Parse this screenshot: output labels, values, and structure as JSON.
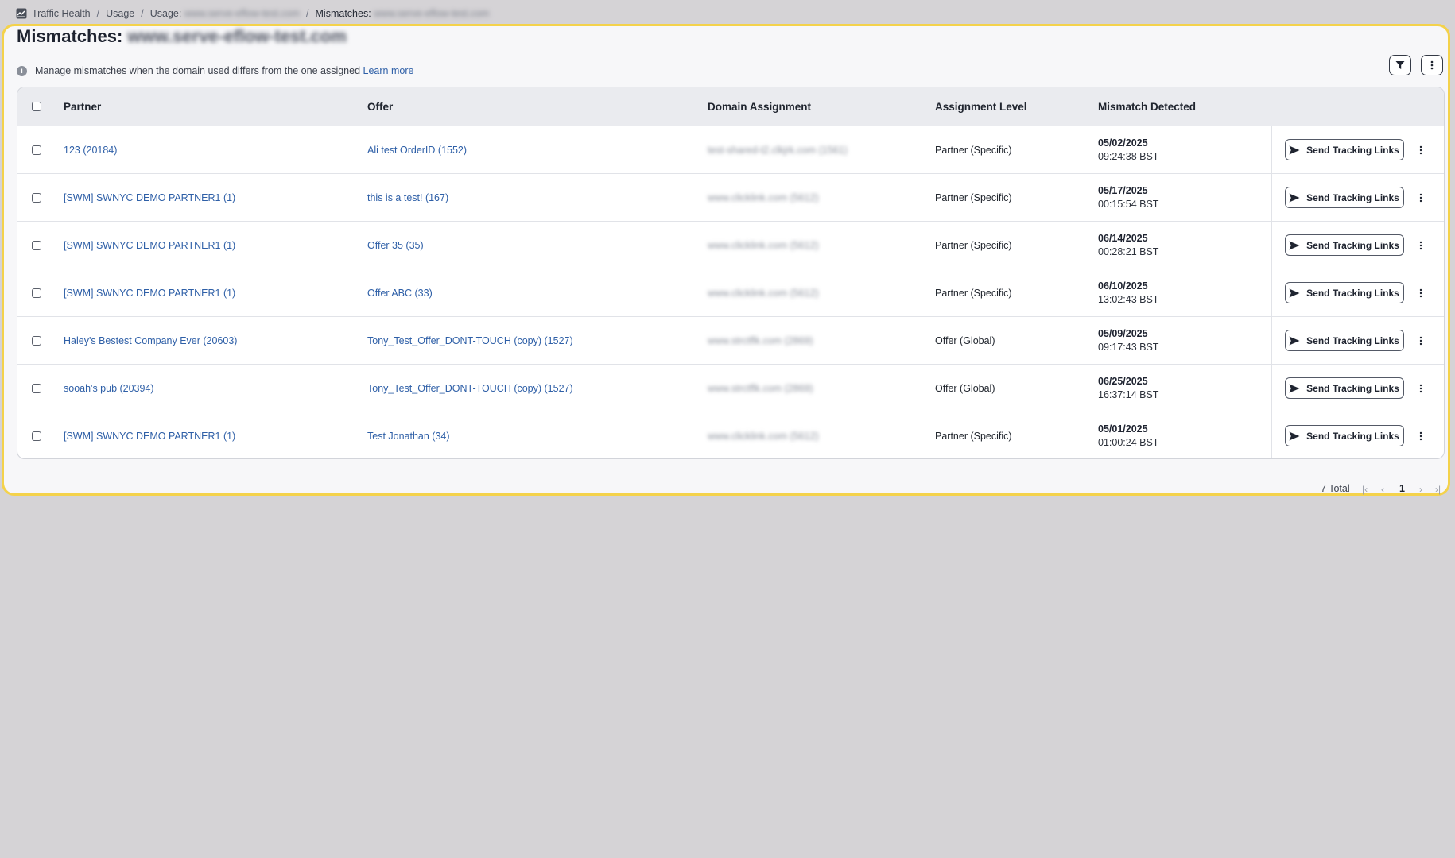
{
  "breadcrumb": {
    "items": [
      "Traffic Health",
      "Usage",
      "Usage:",
      "Mismatches:"
    ],
    "usage_domain": "www.serve-eflow-test.com",
    "mismatch_domain": "www.serve-eflow-test.com",
    "separator": "/"
  },
  "header": {
    "title": "Mismatches:",
    "title_domain": "www.serve-eflow-test.com"
  },
  "info": {
    "text": "Manage mismatches when the domain used differs from the one assigned",
    "link": "Learn more"
  },
  "table": {
    "columns": [
      "Partner",
      "Offer",
      "Domain Assignment",
      "Assignment Level",
      "Mismatch Detected"
    ],
    "action_label": "Send Tracking Links",
    "rows": [
      {
        "partner": "123 (20184)",
        "offer": "Ali test OrderID (1552)",
        "domain": "test-shared-t2.clkjrk.com (1561)",
        "level": "Partner (Specific)",
        "date": "05/02/2025",
        "time": "09:24:38 BST"
      },
      {
        "partner": "[SWM] SWNYC DEMO PARTNER1 (1)",
        "offer": "this is a test! (167)",
        "domain": "www.clicklink.com (5612)",
        "level": "Partner (Specific)",
        "date": "05/17/2025",
        "time": "00:15:54 BST"
      },
      {
        "partner": "[SWM] SWNYC DEMO PARTNER1 (1)",
        "offer": "Offer 35 (35)",
        "domain": "www.clicklink.com (5612)",
        "level": "Partner (Specific)",
        "date": "06/14/2025",
        "time": "00:28:21 BST"
      },
      {
        "partner": "[SWM] SWNYC DEMO PARTNER1 (1)",
        "offer": "Offer ABC (33)",
        "domain": "www.clicklink.com (5612)",
        "level": "Partner (Specific)",
        "date": "06/10/2025",
        "time": "13:02:43 BST"
      },
      {
        "partner": "Haley's Bestest Company Ever (20603)",
        "offer": "Tony_Test_Offer_DONT-TOUCH (copy) (1527)",
        "domain": "www.strctflk.com (2869)",
        "level": "Offer (Global)",
        "date": "05/09/2025",
        "time": "09:17:43 BST"
      },
      {
        "partner": "sooah's pub (20394)",
        "offer": "Tony_Test_Offer_DONT-TOUCH (copy) (1527)",
        "domain": "www.strctflk.com (2869)",
        "level": "Offer (Global)",
        "date": "06/25/2025",
        "time": "16:37:14 BST"
      },
      {
        "partner": "[SWM] SWNYC DEMO PARTNER1 (1)",
        "offer": "Test Jonathan (34)",
        "domain": "www.clicklink.com (5612)",
        "level": "Partner (Specific)",
        "date": "05/01/2025",
        "time": "01:00:24 BST"
      }
    ]
  },
  "pagination": {
    "total": "7 Total",
    "current_page": "1"
  },
  "icons": {
    "breadcrumb": "traffic-health-icon",
    "info": "info-icon",
    "filter": "filter-icon",
    "more": "kebab-icon",
    "send": "send-icon"
  },
  "colors": {
    "highlight_border": "#f4d24b",
    "link": "#2e5fa7",
    "background": "#d5d3d6"
  }
}
